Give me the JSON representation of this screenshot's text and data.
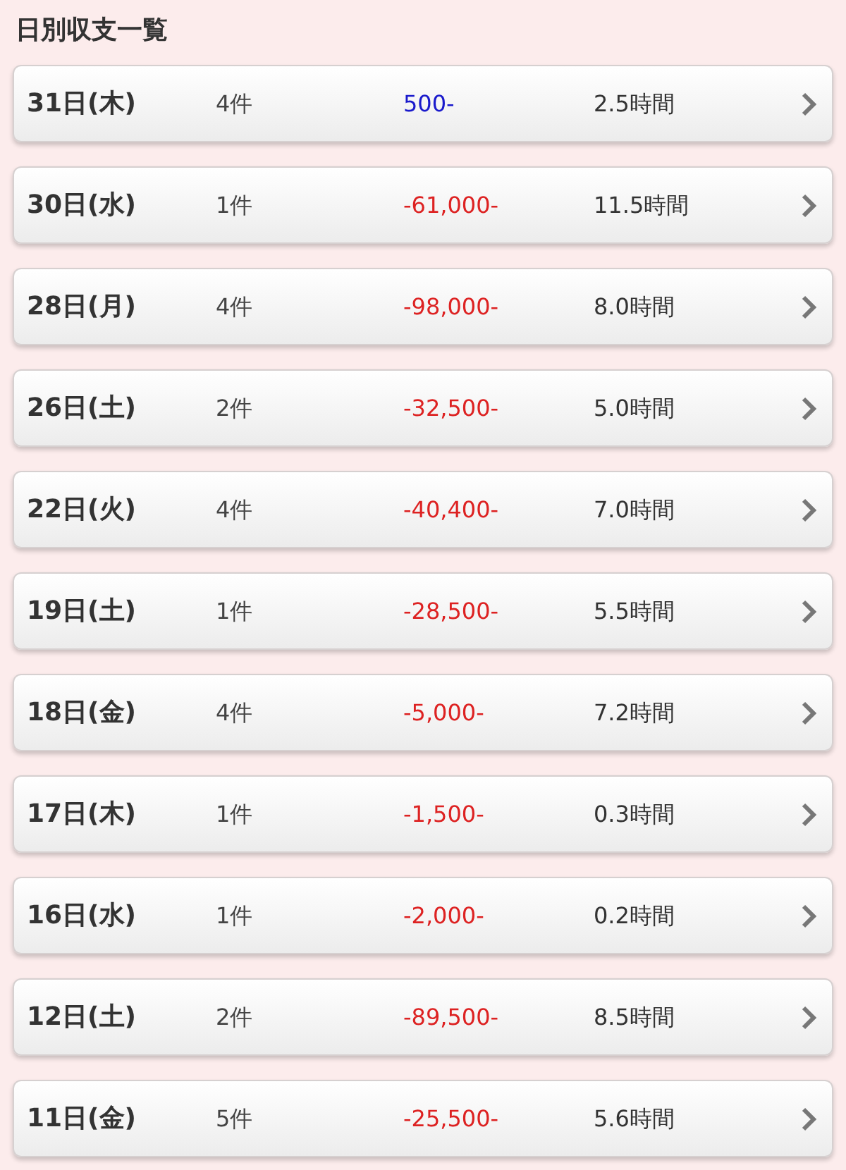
{
  "title": "日別収支一覧",
  "rows": [
    {
      "date": "31日(木)",
      "count": "4件",
      "amount": "500-",
      "color": "#1a1acc",
      "hours": "2.5時間"
    },
    {
      "date": "30日(水)",
      "count": "1件",
      "amount": "-61,000-",
      "color": "#dd2222",
      "hours": "11.5時間"
    },
    {
      "date": "28日(月)",
      "count": "4件",
      "amount": "-98,000-",
      "color": "#dd2222",
      "hours": "8.0時間"
    },
    {
      "date": "26日(土)",
      "count": "2件",
      "amount": "-32,500-",
      "color": "#dd2222",
      "hours": "5.0時間"
    },
    {
      "date": "22日(火)",
      "count": "4件",
      "amount": "-40,400-",
      "color": "#dd2222",
      "hours": "7.0時間"
    },
    {
      "date": "19日(土)",
      "count": "1件",
      "amount": "-28,500-",
      "color": "#dd2222",
      "hours": "5.5時間"
    },
    {
      "date": "18日(金)",
      "count": "4件",
      "amount": "-5,000-",
      "color": "#dd2222",
      "hours": "7.2時間"
    },
    {
      "date": "17日(木)",
      "count": "1件",
      "amount": "-1,500-",
      "color": "#dd2222",
      "hours": "0.3時間"
    },
    {
      "date": "16日(水)",
      "count": "1件",
      "amount": "-2,000-",
      "color": "#dd2222",
      "hours": "0.2時間"
    },
    {
      "date": "12日(土)",
      "count": "2件",
      "amount": "-89,500-",
      "color": "#dd2222",
      "hours": "8.5時間"
    },
    {
      "date": "11日(金)",
      "count": "5件",
      "amount": "-25,500-",
      "color": "#dd2222",
      "hours": "5.6時間"
    }
  ]
}
